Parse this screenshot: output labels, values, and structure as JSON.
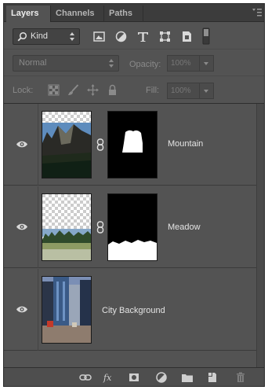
{
  "tabs": [
    {
      "label": "Layers",
      "active": true
    },
    {
      "label": "Channels",
      "active": false
    },
    {
      "label": "Paths",
      "active": false
    }
  ],
  "filter": {
    "kind_label": "Kind",
    "icons": [
      "pixel-filter-icon",
      "adjustment-filter-icon",
      "type-filter-icon",
      "shape-filter-icon",
      "smart-object-filter-icon",
      "filter-toggle-icon"
    ]
  },
  "blend": {
    "mode": "Normal",
    "opacity_label": "Opacity:",
    "opacity_value": "100%"
  },
  "lock": {
    "label": "Lock:",
    "icons": [
      "lock-transparent-pixels-icon",
      "lock-image-pixels-icon",
      "lock-position-icon",
      "lock-all-icon"
    ],
    "fill_label": "Fill:",
    "fill_value": "100%"
  },
  "layers": [
    {
      "name": "Mountain",
      "visible": true,
      "has_mask": true
    },
    {
      "name": "Meadow",
      "visible": true,
      "has_mask": true
    },
    {
      "name": "City Background",
      "visible": true,
      "has_mask": false
    }
  ],
  "bottom_icons": [
    "link-layers-icon",
    "fx-icon",
    "add-mask-icon",
    "adjustment-layer-icon",
    "group-folder-icon",
    "new-layer-icon",
    "trash-icon"
  ],
  "colors": {
    "panel_bg": "#535353",
    "tab_bar_bg": "#3c3c3c",
    "mask_black": "#000000",
    "mask_white": "#ffffff"
  }
}
